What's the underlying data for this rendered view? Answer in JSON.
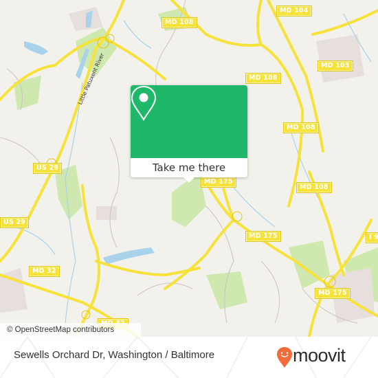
{
  "map": {
    "attribution": "© OpenStreetMap contributors",
    "river_label": "Little Patuxent River",
    "road_shields": [
      {
        "label": "MD 108"
      },
      {
        "label": "MD 104"
      },
      {
        "label": "MD 103"
      },
      {
        "label": "MD 108"
      },
      {
        "label": "MD 108"
      },
      {
        "label": "MD 108"
      },
      {
        "label": "US 29"
      },
      {
        "label": "US 29"
      },
      {
        "label": "MD 175"
      },
      {
        "label": "MD 175"
      },
      {
        "label": "MD 175"
      },
      {
        "label": "MD 32"
      },
      {
        "label": "MD 32"
      },
      {
        "label": "I 9"
      }
    ],
    "colors": {
      "land": "#f2f1ec",
      "road": "#f7e23a",
      "water": "#a8d3ea",
      "park": "#cfe8b0",
      "popup_accent": "#1fb86a"
    }
  },
  "popup": {
    "icon": "map-pin-icon",
    "button_label": "Take me there"
  },
  "footer": {
    "location_title": "Sewells Orchard Dr, Washington / Baltimore",
    "brand": "moovit",
    "brand_color": "#f26b3a"
  }
}
